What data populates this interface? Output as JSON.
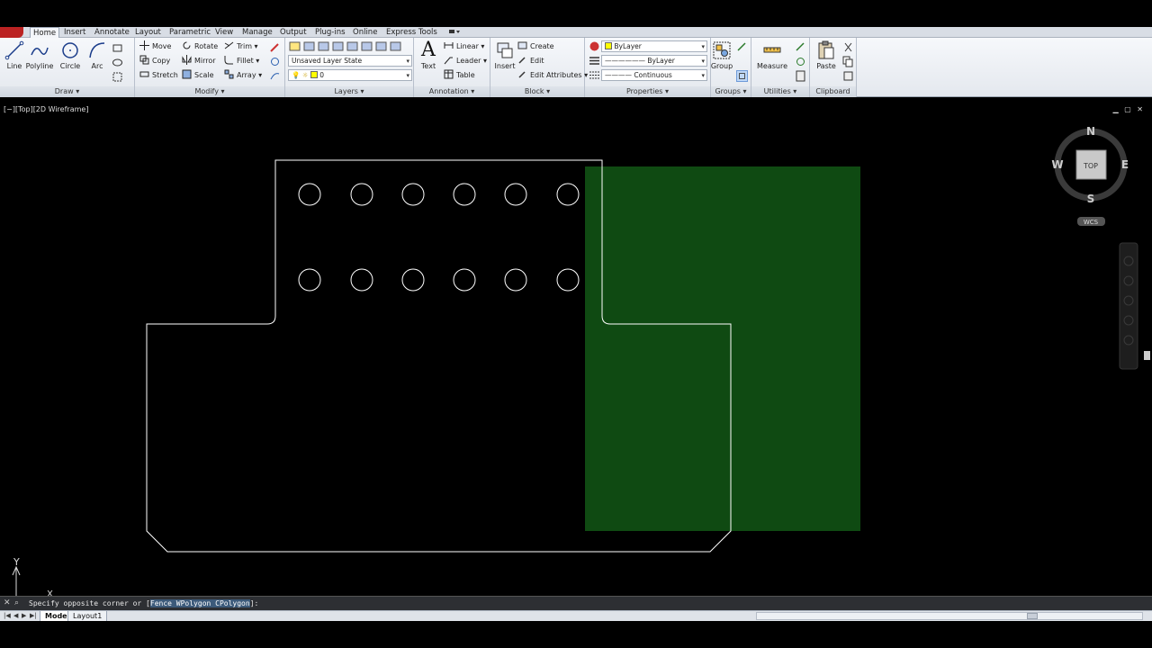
{
  "tabs": [
    "Home",
    "Insert",
    "Annotate",
    "Layout",
    "Parametric",
    "View",
    "Manage",
    "Output",
    "Plug-ins",
    "Online",
    "Express Tools"
  ],
  "active_tab": "Home",
  "draw": {
    "title": "Draw",
    "tools": [
      "Line",
      "Polyline",
      "Circle",
      "Arc"
    ]
  },
  "modify": {
    "title": "Modify",
    "tools": [
      "Move",
      "Rotate",
      "Trim",
      "Copy",
      "Mirror",
      "Fillet",
      "Stretch",
      "Scale",
      "Array"
    ]
  },
  "layers": {
    "title": "Layers",
    "layer_state": "Unsaved Layer State",
    "current_layer": "0"
  },
  "annotation": {
    "title": "Annotation",
    "big": "Text",
    "tools": [
      "Linear",
      "Leader",
      "Table"
    ]
  },
  "block": {
    "title": "Block",
    "big": "Insert",
    "tools": [
      "Create",
      "Edit",
      "Edit Attributes"
    ]
  },
  "properties": {
    "title": "Properties",
    "color": "ByLayer",
    "lineweight": "ByLayer",
    "linetype": "Continuous"
  },
  "groups": {
    "title": "Groups",
    "big": "Group"
  },
  "utilities": {
    "title": "Utilities",
    "big": "Measure"
  },
  "clipboard": {
    "title": "Clipboard",
    "big": "Paste"
  },
  "viewport": {
    "label": "[−][Top][2D Wireframe]",
    "controls": [
      "▁",
      "▢",
      "✕"
    ]
  },
  "viewcube": {
    "north": "N",
    "south": "S",
    "east": "E",
    "west": "W",
    "face": "TOP",
    "ucs": "WCS"
  },
  "ucs_icon": {
    "y": "Y",
    "x": "X"
  },
  "command": {
    "prompt": "Specify opposite corner or [",
    "opt1": "F",
    "opt1_rest": "ence ",
    "opt2": "W",
    "opt2_rest": "Polygon ",
    "opt3": "C",
    "opt3_rest": "Polygon",
    "end": "]:"
  },
  "layout_tabs": [
    "Model",
    "Layout1"
  ],
  "colors": {
    "selection_window": "#0f4a12",
    "drawing_lines": "#ffffff"
  },
  "holes": {
    "rows": 2,
    "cols": 6
  }
}
